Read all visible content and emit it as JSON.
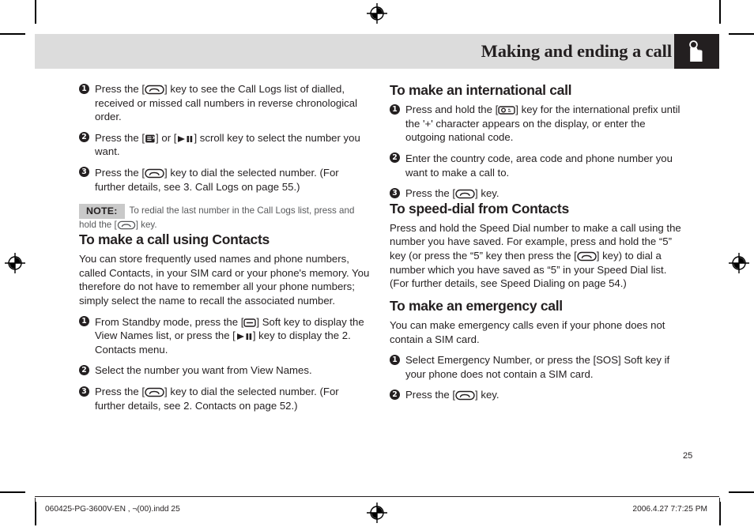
{
  "header": {
    "title": "Making and ending a call",
    "icon": "hand-press-icon",
    "band_color": "#dcdcdc",
    "icon_box_color": "#231f20"
  },
  "left_column": {
    "steps_calllogs": [
      {
        "num": "1",
        "pre": "Press the [",
        "key": "send-key",
        "post": "] key to see the Call Logs list of dialled, received or missed call numbers in reverse chronological order."
      },
      {
        "num": "2",
        "pre": "Press the [",
        "key": "scroll-key",
        "mid": "] or [",
        "key2": "playpause-key",
        "post": "] scroll key to select the number you want."
      },
      {
        "num": "3",
        "pre": "Press the [",
        "key": "send-key",
        "post": "] key to dial the selected number. (For further details, see 3. Call Logs on page 55.)"
      }
    ],
    "note": {
      "tag": "NOTE:",
      "text_before": "To redial the last number in the Call Logs list, press and hold the [",
      "key": "send-key",
      "text_after": "] key."
    },
    "contacts_heading": "To make a call using Contacts",
    "contacts_paragraph": "You can store frequently used names and phone numbers, called Contacts, in your SIM card or your phone's memory. You therefore do not have to remember all your phone numbers; simply select the name to recall the associated number.",
    "steps_contacts": [
      {
        "num": "1",
        "pre": "From Standby mode, press the [",
        "key": "softkey",
        "mid": "] Soft key to display the View Names list, or press the [",
        "key2": "playpause-key",
        "post": "] key to display the 2. Contacts menu."
      },
      {
        "num": "2",
        "text": "Select the number you want from View Names."
      },
      {
        "num": "3",
        "pre": "Press the [",
        "key": "send-key",
        "post": "] key to dial the selected number. (For further details, see 2. Contacts on page 52.)"
      }
    ]
  },
  "right_column": {
    "international_heading": "To make an international call",
    "steps_international": [
      {
        "num": "1",
        "pre": "Press and hold the [",
        "key": "zero-key",
        "post": "] key for the international prefix until the '+' character appears on the display, or enter the outgoing national code."
      },
      {
        "num": "2",
        "text": "Enter the country code, area code and phone number you want to make a call to."
      },
      {
        "num": "3",
        "pre": "Press the [",
        "key": "send-key",
        "post": "] key."
      }
    ],
    "speeddial_heading": "To speed-dial from Contacts",
    "speeddial_paragraph_a": "Press and hold the Speed Dial number to make a call using the number you have saved. For example, press and hold the “5” key (or press the “5” key then press the [",
    "speeddial_key": "send-key",
    "speeddial_paragraph_b": "] key) to dial a number which you have saved as “5” in your Speed Dial list. (For further details, see Speed Dialing on page 54.)",
    "emergency_heading": "To make an emergency call",
    "emergency_paragraph": "You can make emergency calls even if your phone does not contain a SIM card.",
    "steps_emergency": [
      {
        "num": "1",
        "text": "Select Emergency Number, or press the [SOS] Soft key if your phone does not contain a SIM card."
      },
      {
        "num": "2",
        "pre": "Press the [",
        "key": "send-key",
        "post": "] key."
      }
    ]
  },
  "page_number": "25",
  "footer": {
    "filename": "060425-PG-3600V-EN , ¬(00).indd   25",
    "timestamp": "2006.4.27   7:7:25 PM"
  }
}
